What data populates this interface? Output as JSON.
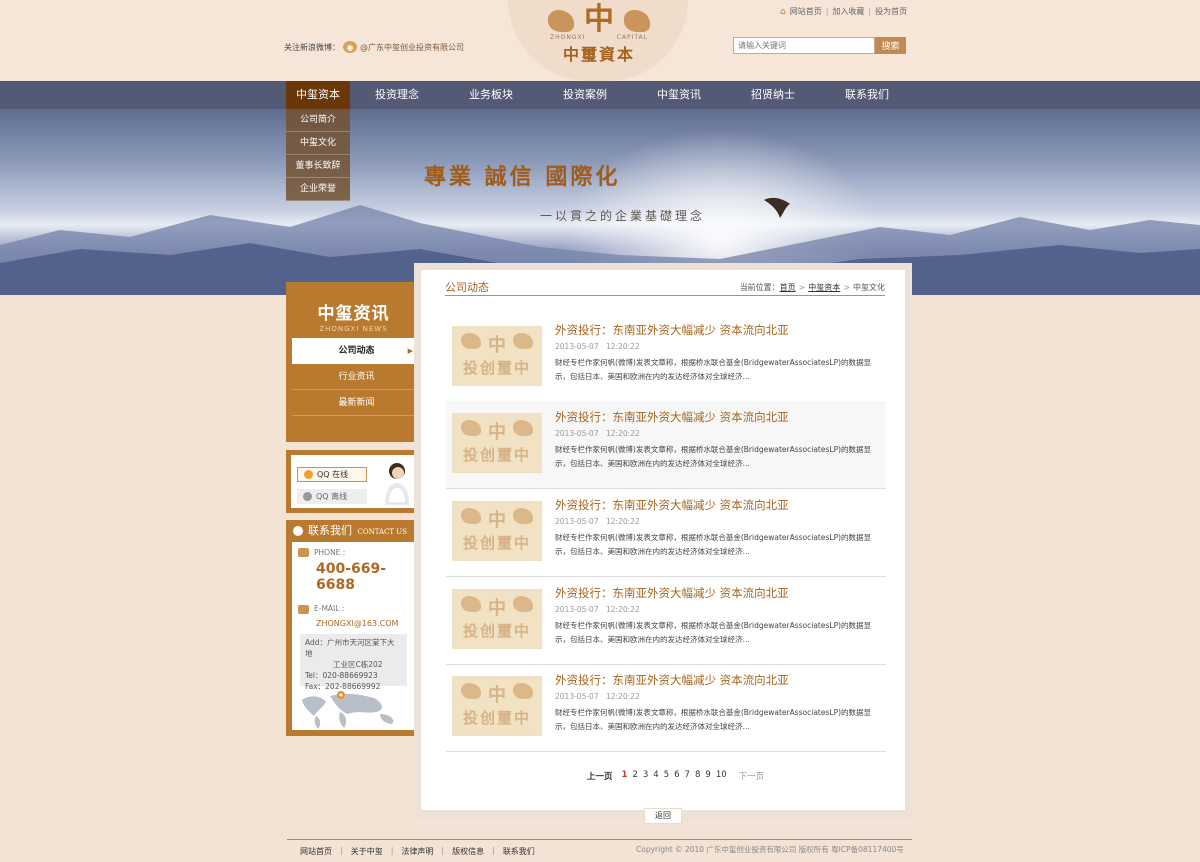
{
  "header": {
    "logo": {
      "big": "中",
      "en_left": "ZHONGXI",
      "en_right": "CAPITAL",
      "cn": "中璽資本"
    },
    "weibo": {
      "label": "关注新浪微博：",
      "icon": "weibo-icon",
      "link": "@广东中玺创业投资有限公司"
    },
    "toplinks": {
      "home": "网站首页",
      "favorite": "加入收藏",
      "contribute": "投为首页",
      "sep": "|"
    },
    "search": {
      "placeholder": "请输入关键词",
      "button": "搜索"
    }
  },
  "nav": {
    "items": [
      "中玺资本",
      "投资理念",
      "业务板块",
      "投资案例",
      "中玺资讯",
      "招贤纳士",
      "联系我们"
    ]
  },
  "subnav": {
    "items": [
      "公司简介",
      "中玺文化",
      "董事长致辞",
      "企业荣誉"
    ]
  },
  "banner": {
    "slogan": "專業  誠信  國際化",
    "subslogan": "一以貫之的企業基礎理念"
  },
  "sidebar": {
    "news": {
      "title": "中玺资讯",
      "subtitle": "ZHONGXI NEWS",
      "items": [
        "公司动态",
        "行业资讯",
        "最新新闻"
      ]
    },
    "qq": {
      "online": "QQ 在线",
      "offline": "QQ 离线"
    },
    "contact": {
      "title": "联系我们",
      "title_en": "CONTACT US",
      "phone_label": "PHONE :",
      "phone": "400-669-6688",
      "email_label": "E-MAIL :",
      "email": "ZHONGXI@163.COM",
      "addr1": "Add：广州市天河区棠下大地",
      "addr2": "工业区C栋202",
      "tel": "Tel：020-88669923",
      "fax": "Fax：202-88669992"
    }
  },
  "main": {
    "section_title": "公司动态",
    "breadcrumb": {
      "label": "当前位置：",
      "home": "首页",
      "parent": "中玺资本",
      "current": "中玺文化",
      "arrow": ">"
    },
    "thumb": {
      "big": "中",
      "bottom": "投创璽中"
    },
    "articles": [
      {
        "title": "外资投行：东南亚外资大幅减少 资本流向北亚",
        "date": "2013-05-07  12:20:22",
        "desc": "财经专栏作家何帆(微博)发表文章称，根据桥水联合基金(BridgewaterAssociatesLP)的数据显示，包括日本、美国和欧洲在内的发达经济体对全球经济…"
      },
      {
        "title": "外资投行：东南亚外资大幅减少 资本流向北亚",
        "date": "2013-05-07  12:20:22",
        "desc": "财经专栏作家何帆(微博)发表文章称，根据桥水联合基金(BridgewaterAssociatesLP)的数据显示，包括日本、美国和欧洲在内的发达经济体对全球经济…"
      },
      {
        "title": "外资投行：东南亚外资大幅减少 资本流向北亚",
        "date": "2013-05-07  12:20:22",
        "desc": "财经专栏作家何帆(微博)发表文章称，根据桥水联合基金(BridgewaterAssociatesLP)的数据显示，包括日本、美国和欧洲在内的发达经济体对全球经济…"
      },
      {
        "title": "外资投行：东南亚外资大幅减少 资本流向北亚",
        "date": "2013-05-07  12:20:22",
        "desc": "财经专栏作家何帆(微博)发表文章称，根据桥水联合基金(BridgewaterAssociatesLP)的数据显示，包括日本、美国和欧洲在内的发达经济体对全球经济…"
      },
      {
        "title": "外资投行：东南亚外资大幅减少 资本流向北亚",
        "date": "2013-05-07  12:20:22",
        "desc": "财经专栏作家何帆(微博)发表文章称，根据桥水联合基金(BridgewaterAssociatesLP)的数据显示，包括日本、美国和欧洲在内的发达经济体对全球经济…"
      }
    ],
    "pager": {
      "prev": "上一页",
      "pages": [
        "1",
        "2",
        "3",
        "4",
        "5",
        "6",
        "7",
        "8",
        "9",
        "10"
      ],
      "current": "1",
      "next": "下一页"
    },
    "back": "返回"
  },
  "footer": {
    "links": [
      "网站首页",
      "关于中玺",
      "法律声明",
      "版权信息",
      "联系我们"
    ],
    "sep": "|",
    "copyright": "Copyright © 2010 广东中玺创业投资有限公司 版权所有 粤ICP备08117400号"
  },
  "colors": {
    "accent": "#b97a2f",
    "nav_active": "#6a3708",
    "title": "#a4651f",
    "page_bg": "#f2e3d5"
  }
}
